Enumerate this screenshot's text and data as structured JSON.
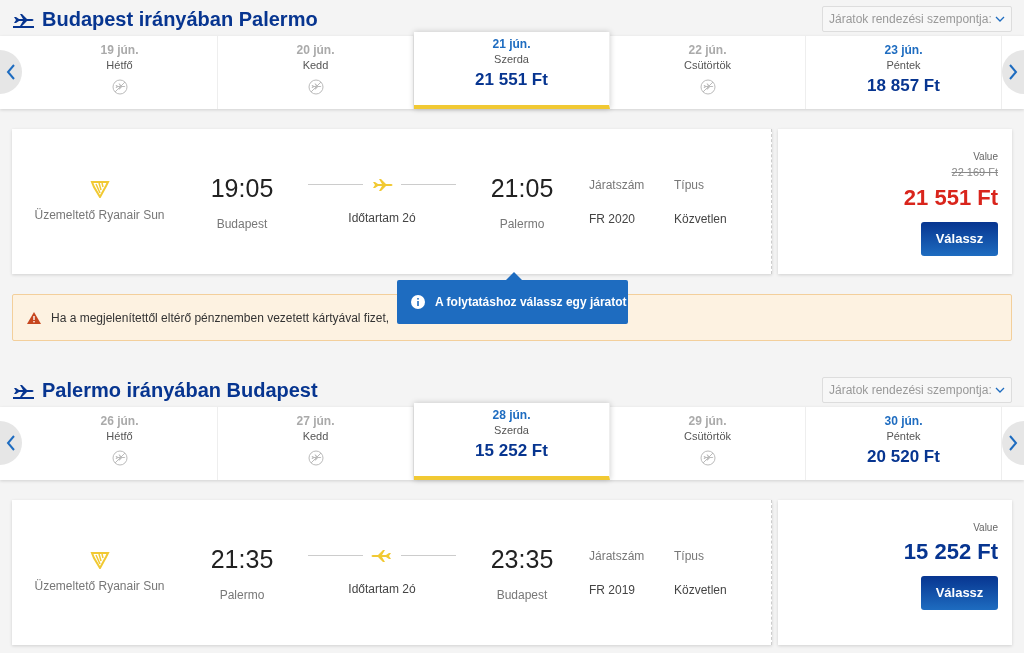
{
  "sections": [
    {
      "title": "Budapest irányában Palermo",
      "sort_placeholder": "Járatok rendezési szempontja:",
      "days": [
        {
          "date": "19 jún.",
          "weekday": "Hétfő",
          "selected": false
        },
        {
          "date": "20 jún.",
          "weekday": "Kedd",
          "selected": false
        },
        {
          "date": "21 jún.",
          "weekday": "Szerda",
          "price": "21 551 Ft",
          "selected": true
        },
        {
          "date": "22 jún.",
          "weekday": "Csütörtök",
          "selected": false
        },
        {
          "date": "23 jún.",
          "weekday": "Péntek",
          "price": "18 857 Ft",
          "selected": false
        }
      ],
      "flight": {
        "operator": "Üzemeltető Ryanair Sun",
        "dep_time": "19:05",
        "dep_city": "Budapest",
        "duration": "Időtartam 2ó",
        "reversed": false,
        "arr_time": "21:05",
        "arr_city": "Palermo",
        "number_label": "Járatszám",
        "number": "FR 2020",
        "type_label": "Típus",
        "type": "Közvetlen",
        "fare_label": "Value",
        "old_price": "22 169 Ft",
        "price": "21 551 Ft",
        "highlighted": true,
        "button": "Válassz"
      }
    },
    {
      "title": "Palermo irányában Budapest",
      "sort_placeholder": "Járatok rendezési szempontja:",
      "days": [
        {
          "date": "26 jún.",
          "weekday": "Hétfő",
          "selected": false
        },
        {
          "date": "27 jún.",
          "weekday": "Kedd",
          "selected": false
        },
        {
          "date": "28 jún.",
          "weekday": "Szerda",
          "price": "15 252 Ft",
          "selected": true
        },
        {
          "date": "29 jún.",
          "weekday": "Csütörtök",
          "selected": false
        },
        {
          "date": "30 jún.",
          "weekday": "Péntek",
          "price": "20 520 Ft",
          "selected": false
        }
      ],
      "flight": {
        "operator": "Üzemeltető Ryanair Sun",
        "dep_time": "21:35",
        "dep_city": "Palermo",
        "duration": "Időtartam 2ó",
        "reversed": true,
        "arr_time": "23:35",
        "arr_city": "Budapest",
        "number_label": "Járatszám",
        "number": "FR 2019",
        "type_label": "Típus",
        "type": "Közvetlen",
        "fare_label": "Value",
        "price": "15 252 Ft",
        "highlighted": false,
        "button": "Válassz"
      }
    }
  ],
  "alert": {
    "text": "Ha a megjelenítettől eltérő pénznemben vezetett kártyával fizet,"
  },
  "tooltip": {
    "text": "A folytatáshoz válassz egy járatot"
  }
}
